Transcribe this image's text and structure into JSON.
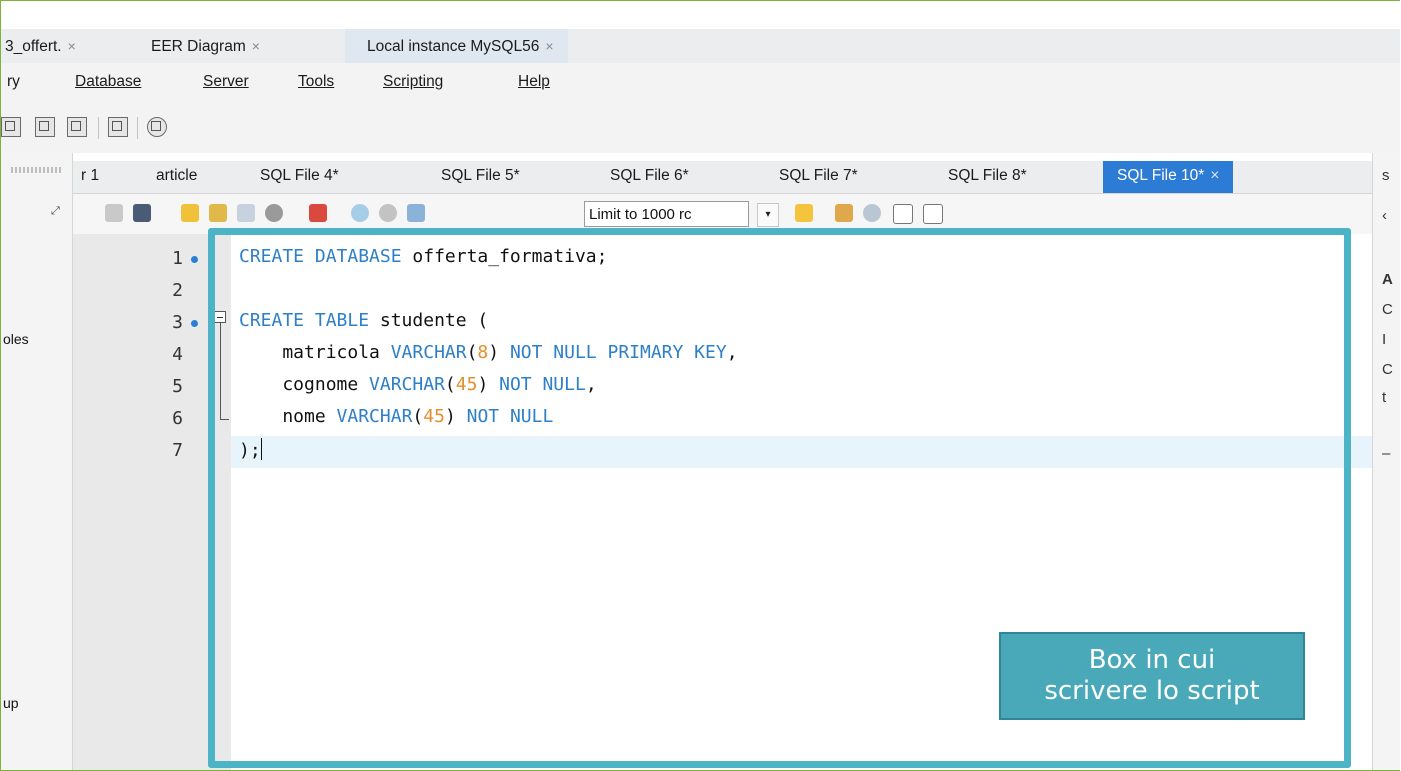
{
  "doc_tabs": [
    {
      "label": "3_offert.",
      "close": "×"
    },
    {
      "label": "EER Diagram",
      "close": "×"
    },
    {
      "label": "Local instance MySQL56",
      "close": "×"
    }
  ],
  "menu": [
    "ry",
    "Database",
    "Server",
    "Tools",
    "Scripting",
    "Help"
  ],
  "left_panel": {
    "labels": [
      "oles",
      "up"
    ]
  },
  "sql_tabs": [
    {
      "label": "r 1"
    },
    {
      "label": "article"
    },
    {
      "label": "SQL File 4*"
    },
    {
      "label": "SQL File 5*"
    },
    {
      "label": "SQL File 6*"
    },
    {
      "label": "SQL File 7*"
    },
    {
      "label": "SQL File 8*"
    },
    {
      "label": "SQL File 10*",
      "close": "×",
      "active": true
    }
  ],
  "toolbar": {
    "limit_label": "Limit to 1000 rc",
    "limit_arrow": "▾"
  },
  "editor": {
    "line_numbers": [
      "1",
      "2",
      "3",
      "4",
      "5",
      "6",
      "7"
    ],
    "lines": [
      {
        "n": "1",
        "segs": [
          [
            "kw",
            "CREATE DATABASE"
          ],
          [
            "",
            " offerta_formativa;"
          ]
        ]
      },
      {
        "n": "2",
        "segs": []
      },
      {
        "n": "3",
        "segs": [
          [
            "kw",
            "CREATE TABLE"
          ],
          [
            "",
            " studente ("
          ]
        ]
      },
      {
        "n": "4",
        "segs": [
          [
            "",
            "    matricola "
          ],
          [
            "kw",
            "VARCHAR"
          ],
          [
            "",
            "("
          ],
          [
            "num",
            "8"
          ],
          [
            "",
            ") "
          ],
          [
            "kw",
            "NOT NULL PRIMARY KEY"
          ],
          [
            "",
            ","
          ]
        ]
      },
      {
        "n": "5",
        "segs": [
          [
            "",
            "    cognome "
          ],
          [
            "kw",
            "VARCHAR"
          ],
          [
            "",
            "("
          ],
          [
            "num",
            "45"
          ],
          [
            "",
            ") "
          ],
          [
            "kw",
            "NOT NULL"
          ],
          [
            "",
            ","
          ]
        ]
      },
      {
        "n": "6",
        "segs": [
          [
            "",
            "    nome "
          ],
          [
            "kw",
            "VARCHAR"
          ],
          [
            "",
            "("
          ],
          [
            "num",
            "45"
          ],
          [
            "",
            ") "
          ],
          [
            "kw",
            "NOT NULL"
          ]
        ]
      },
      {
        "n": "7",
        "segs": [
          [
            "",
            ");"
          ]
        ]
      }
    ]
  },
  "right_panel": {
    "letters": [
      "s",
      "‹",
      "A",
      "C",
      "I",
      "C",
      "t",
      "–"
    ]
  },
  "callout": {
    "line1": "Box in cui",
    "line2": "scrivere lo script"
  },
  "colors": {
    "accent": "#2c7bd5",
    "highlight": "#4db3c6",
    "callout": "#4aa9b8",
    "keyword": "#2d7fc8",
    "number": "#e58f2b"
  }
}
